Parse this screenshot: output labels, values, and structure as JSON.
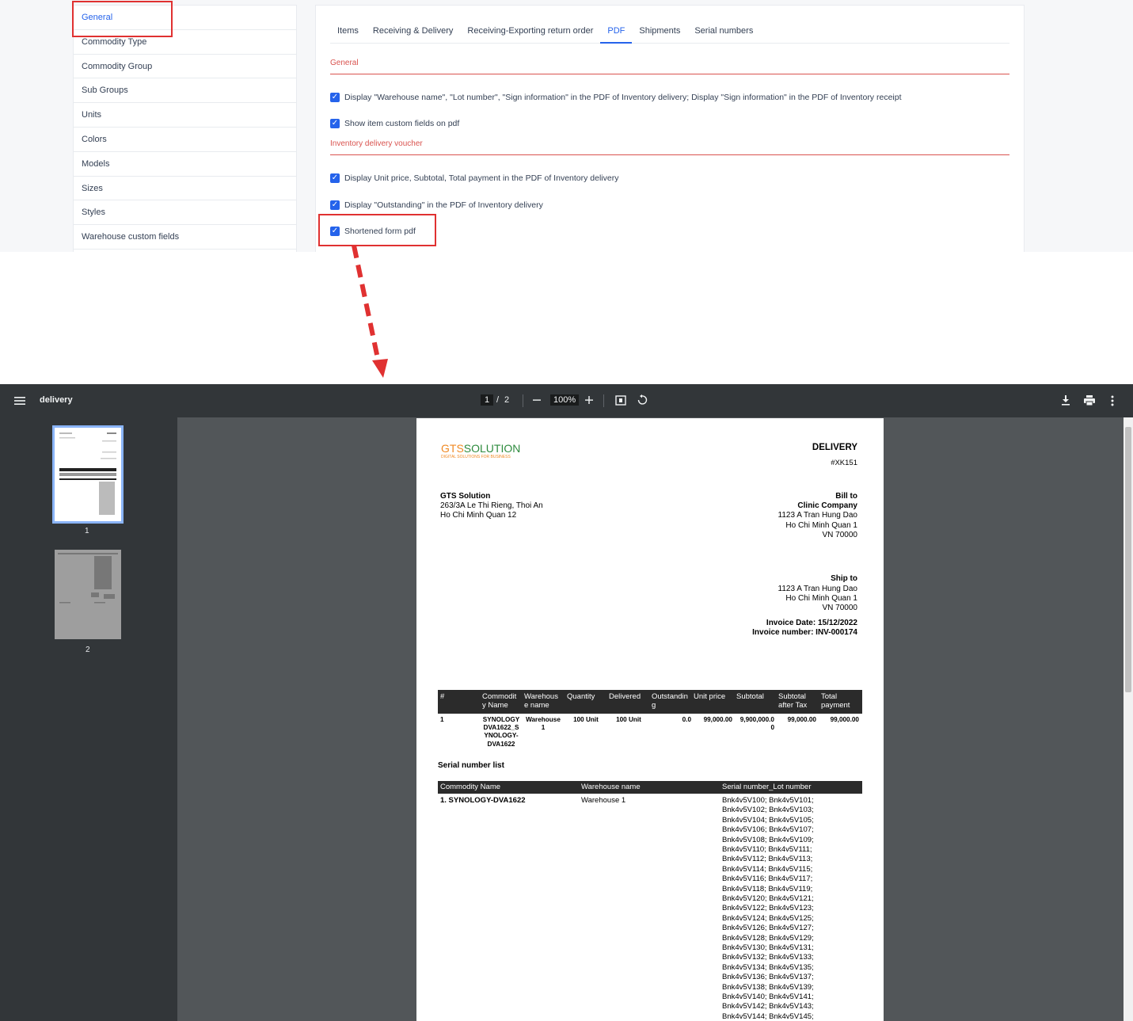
{
  "settings": {
    "left_menu": [
      "General",
      "Commodity Type",
      "Commodity Group",
      "Sub Groups",
      "Units",
      "Colors",
      "Models",
      "Sizes",
      "Styles",
      "Warehouse custom fields"
    ],
    "tabs": [
      "Items",
      "Receiving & Delivery",
      "Receiving-Exporting return order",
      "PDF",
      "Shipments",
      "Serial numbers"
    ],
    "active_tab": "PDF",
    "general_section": "General",
    "general_options": [
      "Display \"Warehouse name\", \"Lot number\", \"Sign information\" in the PDF of Inventory delivery; Display \"Sign information\" in the PDF of Inventory receipt",
      "Show item custom fields on pdf"
    ],
    "delivery_section": "Inventory delivery voucher",
    "delivery_options": [
      "Display Unit price, Subtotal, Total payment in the PDF of Inventory delivery",
      "Display \"Outstanding\" in the PDF of Inventory delivery",
      "Shortened form pdf"
    ],
    "accent_color": "#2563eb",
    "highlight_color": "#e03131"
  },
  "viewer": {
    "title": "delivery",
    "page_current": "1",
    "page_sep": "/",
    "page_total": "2",
    "zoom": "100%",
    "thumb_labels": [
      "1",
      "2"
    ],
    "icons": [
      "menu-icon",
      "zoom-out-icon",
      "zoom-in-icon",
      "fit-page-icon",
      "rotate-icon",
      "download-icon",
      "print-icon",
      "more-icon"
    ]
  },
  "doc": {
    "logo_gts": "GTS",
    "logo_solution": "SOLUTION",
    "logo_tagline": "DIGITAL SOLUTIONS FOR BUSINESS",
    "title": "DELIVERY",
    "number": "#XK151",
    "company_name": "GTS Solution",
    "company_addr1": "263/3A Le Thi Rieng, Thoi An",
    "company_addr2": "Ho Chi Minh Quan 12",
    "bill_to_label": "Bill to",
    "bill_to_name": "Clinic Company",
    "bill_to_addr1": "1123 A Tran Hung Dao",
    "bill_to_addr2": "Ho Chi Minh Quan 1",
    "bill_to_addr3": "VN 70000",
    "ship_to_label": "Ship to",
    "ship_to_addr1": "1123 A Tran Hung Dao",
    "ship_to_addr2": "Ho Chi Minh Quan 1",
    "ship_to_addr3": "VN 70000",
    "invoice_date": "Invoice Date: 15/12/2022",
    "invoice_number": "Invoice number: INV-000174",
    "table_headers": [
      "#",
      "Commodit y Name",
      "Warehous e name",
      "Quantity",
      "Delivered",
      "Outstandin g",
      "Unit price",
      "Subtotal",
      "Subtotal after Tax",
      "Total payment"
    ],
    "row": {
      "num": "1",
      "name": "SYNOLOGY DVA1622_S YNOLOGY-DVA1622",
      "warehouse": "Warehouse 1",
      "quantity": "100 Unit",
      "delivered": "100 Unit",
      "outstanding": "0.0",
      "unit_price": "99,000.00",
      "subtotal": "9,900,000.0 0",
      "subtotal_after_tax": "99,000.00",
      "total_payment": "99,000.00"
    },
    "serial_title": "Serial number list",
    "serial_headers": [
      "Commodity Name",
      "Warehouse name",
      "Serial number_Lot number"
    ],
    "serial_item": "1. SYNOLOGY-DVA1622",
    "serial_warehouse": "Warehouse 1",
    "serial_lines": [
      "Bnk4v5V100; Bnk4v5V101;",
      "Bnk4v5V102; Bnk4v5V103;",
      "Bnk4v5V104; Bnk4v5V105;",
      "Bnk4v5V106; Bnk4v5V107;",
      "Bnk4v5V108; Bnk4v5V109;",
      "Bnk4v5V110; Bnk4v5V111;",
      "Bnk4v5V112; Bnk4v5V113;",
      "Bnk4v5V114; Bnk4v5V115;",
      "Bnk4v5V116; Bnk4v5V117;",
      "Bnk4v5V118; Bnk4v5V119;",
      "Bnk4v5V120; Bnk4v5V121;",
      "Bnk4v5V122; Bnk4v5V123;",
      "Bnk4v5V124; Bnk4v5V125;",
      "Bnk4v5V126; Bnk4v5V127;",
      "Bnk4v5V128; Bnk4v5V129;",
      "Bnk4v5V130; Bnk4v5V131;",
      "Bnk4v5V132; Bnk4v5V133;",
      "Bnk4v5V134; Bnk4v5V135;",
      "Bnk4v5V136; Bnk4v5V137;",
      "Bnk4v5V138; Bnk4v5V139;",
      "Bnk4v5V140; Bnk4v5V141;",
      "Bnk4v5V142; Bnk4v5V143;",
      "Bnk4v5V144; Bnk4v5V145;"
    ]
  }
}
